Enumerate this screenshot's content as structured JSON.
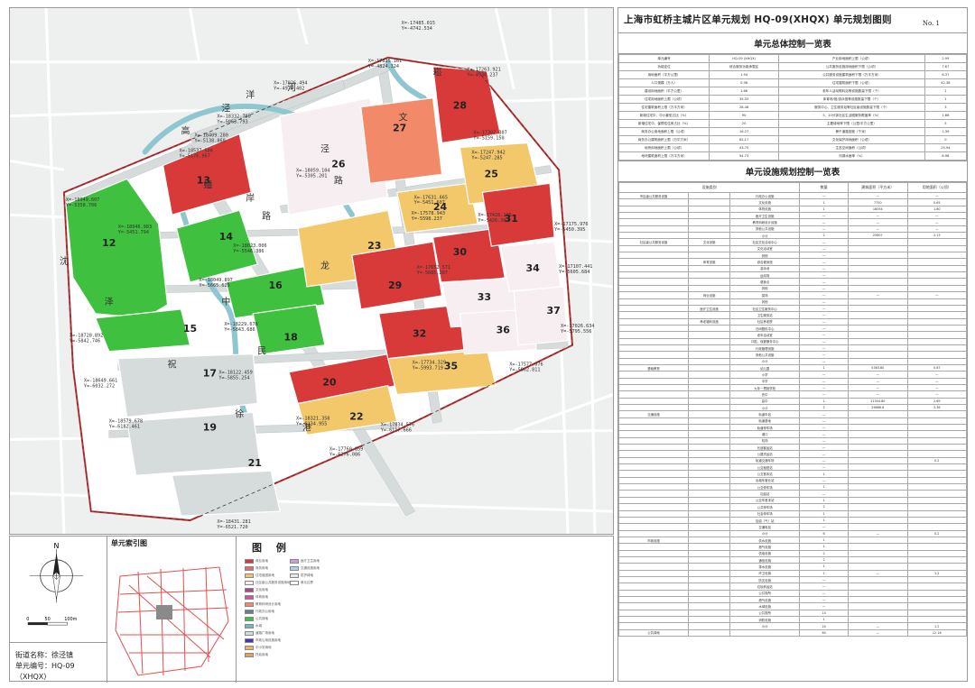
{
  "map": {
    "plots": [
      {
        "id": "12",
        "color": "#3fc13f"
      },
      {
        "id": "13",
        "color": "#d83a3a"
      },
      {
        "id": "14",
        "color": "#3fc13f"
      },
      {
        "id": "15",
        "color": "#3fc13f"
      },
      {
        "id": "16",
        "color": "#3fc13f"
      },
      {
        "id": "17",
        "color": "#d6dbdc"
      },
      {
        "id": "18",
        "color": "#3fc13f"
      },
      {
        "id": "19",
        "color": "#d6dbdc"
      },
      {
        "id": "20",
        "color": "#d83a3a"
      },
      {
        "id": "21",
        "color": "#d6dbdc"
      },
      {
        "id": "22",
        "color": "#f2c86a"
      },
      {
        "id": "23",
        "color": "#f2c86a"
      },
      {
        "id": "24",
        "color": "#f2c86a"
      },
      {
        "id": "25",
        "color": "#f2c86a"
      },
      {
        "id": "26",
        "color": "#f7eef2"
      },
      {
        "id": "27",
        "color": "#f28a6a"
      },
      {
        "id": "28",
        "color": "#d83a3a"
      },
      {
        "id": "29",
        "color": "#d83a3a"
      },
      {
        "id": "30",
        "color": "#d83a3a"
      },
      {
        "id": "31",
        "color": "#d83a3a"
      },
      {
        "id": "32",
        "color": "#d83a3a"
      },
      {
        "id": "33",
        "color": "#f7eef2"
      },
      {
        "id": "34",
        "color": "#f7eef2"
      },
      {
        "id": "35",
        "color": "#f2c86a"
      },
      {
        "id": "36",
        "color": "#f7eef2"
      },
      {
        "id": "37",
        "color": "#f7eef2"
      }
    ],
    "road_labels": [
      {
        "text": "沈"
      },
      {
        "text": "泽"
      },
      {
        "text": "高"
      },
      {
        "text": "泾"
      },
      {
        "text": "洋"
      },
      {
        "text": "河"
      },
      {
        "text": "岸"
      },
      {
        "text": "路"
      },
      {
        "text": "蟠"
      },
      {
        "text": "龙"
      },
      {
        "text": "中"
      },
      {
        "text": "民"
      },
      {
        "text": "祝"
      },
      {
        "text": "徐"
      },
      {
        "text": "港"
      },
      {
        "text": "泾"
      },
      {
        "text": "路"
      },
      {
        "text": "崧"
      },
      {
        "text": "文"
      }
    ],
    "coords": [
      {
        "x": "X=-17485.015",
        "y": "Y=-4742.534"
      },
      {
        "x": "X=-17815.161",
        "y": "Y=-4824.324"
      },
      {
        "x": "X=-17926.494",
        "y": "Y=-4976.402"
      },
      {
        "x": "X=-18332.790",
        "y": "Y=-5063.793"
      },
      {
        "x": "X=-18409.280",
        "y": "Y=-5138.860"
      },
      {
        "x": "X=-18537.504",
        "y": "Y=-5176.967"
      },
      {
        "x": "X=-18949.607",
        "y": "Y=-5358.706"
      },
      {
        "x": "X=-18946.983",
        "y": "Y=-5451.794"
      },
      {
        "x": "X=-18059.104",
        "y": "Y=-5305.201"
      },
      {
        "x": "X=-18023.006",
        "y": "Y=-5546.386"
      },
      {
        "x": "X=-18049.897",
        "y": "Y=-5665.625"
      },
      {
        "x": "X=-18229.678",
        "y": "Y=-5843.686"
      },
      {
        "x": "X=-18728.892",
        "y": "Y=-5842.746"
      },
      {
        "x": "X=-18649.661",
        "y": "Y=-6032.272"
      },
      {
        "x": "X=-18122.459",
        "y": "Y=-5855.254"
      },
      {
        "x": "X=-18579.678",
        "y": "Y=-6182.461"
      },
      {
        "x": "X=-18321.358",
        "y": "Y=-6134.955"
      },
      {
        "x": "X=-17760.859",
        "y": "Y=-6276.086"
      },
      {
        "x": "X=-18431.281",
        "y": "Y=-6521.720"
      },
      {
        "x": "X=-17631.665",
        "y": "Y=-5451.607"
      },
      {
        "x": "X=-17578.943",
        "y": "Y=-5598.237"
      },
      {
        "x": "X=-17652.571",
        "y": "Y=-5685.207"
      },
      {
        "x": "X=-17734.329",
        "y": "Y=-5993.719"
      },
      {
        "x": "X=-17834.576",
        "y": "Y=-6117.666"
      },
      {
        "x": "X=-17428.105",
        "y": "Y=-5426.307"
      },
      {
        "x": "X=-17247.942",
        "y": "Y=-5247.285"
      },
      {
        "x": "X=-17307.307",
        "y": "Y=-5159.150"
      },
      {
        "x": "X=-17175.976",
        "y": "Y=-5450.395"
      },
      {
        "x": "X=-17107.441",
        "y": "Y=-5605.684"
      },
      {
        "x": "X=-17026.634",
        "y": "Y=-5795.556"
      },
      {
        "x": "X=-17577.076",
        "y": "Y=-5962.811"
      },
      {
        "x": "X=-17263.921",
        "y": "Y=-4930.237"
      }
    ]
  },
  "compass": {
    "north": "N",
    "scale": [
      "0",
      "50",
      "100m"
    ]
  },
  "street": {
    "label": "街道名称：徐泾镇",
    "unit_label": "单元编号：HQ-09（XHQX）"
  },
  "index_map": {
    "title": "单元索引图"
  },
  "legend": {
    "title": "图  例",
    "items": [
      {
        "color": "#d83a3a",
        "label": "商业用地"
      },
      {
        "color": "#e46b6b",
        "label": "商务用地"
      },
      {
        "color": "#f2c86a",
        "label": "住宅组团用地"
      },
      {
        "color": "#f7eef2",
        "label": "社区级公共服务设施用地"
      },
      {
        "color": "#a24a8f",
        "label": "文化用地"
      },
      {
        "color": "#d64fa0",
        "label": "体育用地"
      },
      {
        "color": "#f28a6a",
        "label": "教育科研设计用地"
      },
      {
        "color": "#6c7d87",
        "label": "行政办公用地"
      },
      {
        "color": "#3fc13f",
        "label": "公共绿地"
      },
      {
        "color": "#6fb8c4",
        "label": "水域"
      },
      {
        "color": "#d6dbdc",
        "label": "道路广场用地"
      },
      {
        "color": "#3c3cb0",
        "label": "市政公用设施用地"
      },
      {
        "color": "#f2b06a",
        "label": "中小学用地"
      },
      {
        "color": "#e0a060",
        "label": "托幼用地"
      },
      {
        "color": "#c7a0d8",
        "label": "医疗卫生用地"
      },
      {
        "color": "#b0d0e8",
        "label": "交通设施用地"
      },
      {
        "color": "#e8e8e8",
        "label": "防护绿地"
      },
      {
        "color": "#ffffff",
        "label": "单元边界"
      }
    ]
  },
  "right_panel": {
    "title": "上海市虹桥主城片区单元规划  HQ-09(XHQX) 单元规划图则",
    "sheet_no": "No. 1",
    "overall_title": "单元总体控制一览表",
    "overall_rows": [
      [
        "单元编号",
        "HQ-09 (XHQX)",
        "产业用地面积上限（公顷）",
        "2.99"
      ],
      [
        "功能定位",
        "综合服务功能承载区",
        "公共服务设施用地面积下限（公顷）",
        "7.67"
      ],
      [
        "用地面积（平方公里）",
        "1.94",
        "公共服务设施建筑面积下限（万平方米）",
        "6.37"
      ],
      [
        "人口规模（万人）",
        "0.98",
        "住宅建筑面积下限（公顷）",
        "42.38"
      ],
      [
        "建设用地面积（平方公里）",
        "1.66",
        "老年人活动照料站等设施数量下限（个）",
        "1"
      ],
      [
        "住宅用地面积上限（公顷）",
        "35.33",
        "体育场/馆/游泳馆等设施数量下限（个）",
        "1"
      ],
      [
        "住宅建筑面积上限（万平方米）",
        "28.46",
        "服务中心、卫生服务站等社区级设施数量下限（个）",
        "3"
      ],
      [
        "新增住宅中，中小套型占比（%）",
        "90",
        "5、10分钟社区生活圈服务覆盖率（%）",
        "1.86"
      ],
      [
        "新增住宅中，保障性住房占比（%）",
        "20",
        "主要绿地率下限（公里/平方公里）",
        "5"
      ],
      [
        "商务办公用地面积上限（公顷）",
        "16.27",
        "骨干道路密度（千米）",
        "1.39"
      ],
      [
        "商务办公建筑面积上限（万平方米）",
        "82.17",
        "文化保护用地面积（公顷）",
        "0"
      ],
      [
        "地块用地面积上限（公顷）",
        "43.75",
        "生态空间面积（公顷）",
        "25.94"
      ],
      [
        "地块建筑面积上限（万平方米）",
        "94.73",
        "河湖水面率（%）",
        "6.98"
      ]
    ],
    "facility_title": "单元设施规划控制一览表",
    "facility_headers": [
      "设施类别",
      "数量",
      "建筑面积（平方米）",
      "用地面积（公顷）"
    ],
    "facility_rows": [
      [
        "市区级公共服务设施",
        "",
        "行政办公设施",
        "—",
        "—",
        "—"
      ],
      [
        "",
        "",
        "文化设施",
        "1",
        "7750",
        "0.65"
      ],
      [
        "",
        "",
        "体育设施",
        "1",
        "18054",
        "1.80"
      ],
      [
        "",
        "",
        "医疗卫生设施",
        "—",
        "—",
        "—"
      ],
      [
        "",
        "",
        "教育科研设计设施",
        "—",
        "—",
        "—"
      ],
      [
        "",
        "",
        "其他公共设施",
        "—",
        "—",
        "—"
      ],
      [
        "",
        "",
        "小计",
        "2",
        "25807",
        "2.13"
      ],
      [
        "社区级公共服务设施",
        "文化设施",
        "社区文化活动中心",
        "—",
        "",
        ""
      ],
      [
        "",
        "",
        "文化活动室",
        "—",
        "",
        ""
      ],
      [
        "",
        "",
        "其他",
        "—",
        "",
        ""
      ],
      [
        "",
        "体育设施",
        "综合健身馆",
        "—",
        "",
        ""
      ],
      [
        "",
        "",
        "游泳池",
        "—",
        "",
        ""
      ],
      [
        "",
        "",
        "运动场",
        "—",
        "",
        ""
      ],
      [
        "",
        "",
        "健身点",
        "—",
        "",
        ""
      ],
      [
        "",
        "",
        "其他",
        "—",
        "",
        ""
      ],
      [
        "",
        "商业设施",
        "菜场",
        "—",
        "—",
        "—"
      ],
      [
        "",
        "",
        "其他",
        "—",
        "",
        ""
      ],
      [
        "",
        "医疗卫生设施",
        "社区卫生服务中心",
        "—",
        "",
        ""
      ],
      [
        "",
        "",
        "卫生服务站",
        "—",
        "",
        ""
      ],
      [
        "",
        "养老福利设施",
        "社区养老院",
        "—",
        "",
        ""
      ],
      [
        "",
        "",
        "日间照料中心",
        "—",
        "",
        ""
      ],
      [
        "",
        "",
        "老年活动室",
        "—",
        "",
        ""
      ],
      [
        "",
        "",
        "口腔、保健服务中心",
        "—",
        "",
        ""
      ],
      [
        "",
        "",
        "行政管理设施",
        "—",
        "",
        ""
      ],
      [
        "",
        "",
        "其他公共设施",
        "—",
        "",
        ""
      ],
      [
        "",
        "",
        "小计",
        "—",
        "",
        ""
      ],
      [
        "基础教育",
        "",
        "幼儿园",
        "1",
        "5363.80",
        "0.67"
      ],
      [
        "",
        "",
        "小学",
        "—",
        "—",
        "—"
      ],
      [
        "",
        "",
        "中学",
        "—",
        "—",
        "—"
      ],
      [
        "",
        "",
        "九年一贯制学校",
        "—",
        "—",
        "—"
      ],
      [
        "",
        "",
        "完中",
        "—",
        "—",
        "—"
      ],
      [
        "",
        "",
        "高中",
        "1",
        "21304.80",
        "2.69"
      ],
      [
        "",
        "",
        "小计",
        "2",
        "26668.6",
        "3.36"
      ],
      [
        "交通设施",
        "",
        "轨道车站",
        "—",
        "",
        ""
      ],
      [
        "",
        "",
        "轨道基地",
        "—",
        "",
        ""
      ],
      [
        "",
        "",
        "轨道停车场",
        "—",
        "",
        ""
      ],
      [
        "",
        "",
        "港口",
        "—",
        "",
        ""
      ],
      [
        "",
        "",
        "机场",
        "—",
        "",
        ""
      ],
      [
        "",
        "",
        "长途客运站",
        "—",
        "",
        ""
      ],
      [
        "",
        "",
        "公路货运站",
        "—",
        "",
        ""
      ],
      [
        "",
        "",
        "轨道交通车场",
        "—",
        "",
        "0.2"
      ],
      [
        "",
        "",
        "公交枢纽站",
        "—",
        "",
        ""
      ],
      [
        "",
        "",
        "公交首末站",
        "1",
        "",
        ""
      ],
      [
        "",
        "",
        "出租车营业站",
        "—",
        "",
        ""
      ],
      [
        "",
        "",
        "公交停车场",
        "1",
        "",
        ""
      ],
      [
        "",
        "",
        "加油站",
        "—",
        "",
        ""
      ],
      [
        "",
        "",
        "公交车首末站",
        "1",
        "",
        ""
      ],
      [
        "",
        "",
        "公共停车场",
        "2",
        "",
        ""
      ],
      [
        "",
        "",
        "社会停车场",
        "1",
        "",
        ""
      ],
      [
        "",
        "",
        "加油（气）站",
        "1",
        "",
        ""
      ],
      [
        "",
        "",
        "交通电站",
        "—",
        "",
        ""
      ],
      [
        "",
        "",
        "小计",
        "6",
        "—",
        "0.2"
      ],
      [
        "市政设施",
        "",
        "供水设施",
        "1",
        "",
        ""
      ],
      [
        "",
        "",
        "燃气设施",
        "1",
        "",
        ""
      ],
      [
        "",
        "",
        "供电设施",
        "2",
        "",
        ""
      ],
      [
        "",
        "",
        "通信设施",
        "2",
        "",
        ""
      ],
      [
        "",
        "",
        "排水设施",
        "1",
        "",
        ""
      ],
      [
        "",
        "",
        "环卫设施",
        "1",
        "—",
        "1.2"
      ],
      [
        "",
        "",
        "防灾设施",
        "—",
        "",
        ""
      ],
      [
        "",
        "",
        "垃圾转运站",
        "—",
        "",
        ""
      ],
      [
        "",
        "",
        "公共厕所",
        "—",
        "",
        ""
      ],
      [
        "",
        "",
        "燃气设施",
        "—",
        "",
        ""
      ],
      [
        "",
        "",
        "水域设施",
        "—",
        "",
        ""
      ],
      [
        "",
        "",
        "公共厕所",
        "14",
        "",
        ""
      ],
      [
        "",
        "",
        "消防设施",
        "1",
        "",
        ""
      ],
      [
        "",
        "",
        "小计",
        "24",
        "—",
        "1.2"
      ],
      [
        "公共绿地",
        "",
        "",
        "60",
        "—",
        "12.16"
      ]
    ]
  }
}
